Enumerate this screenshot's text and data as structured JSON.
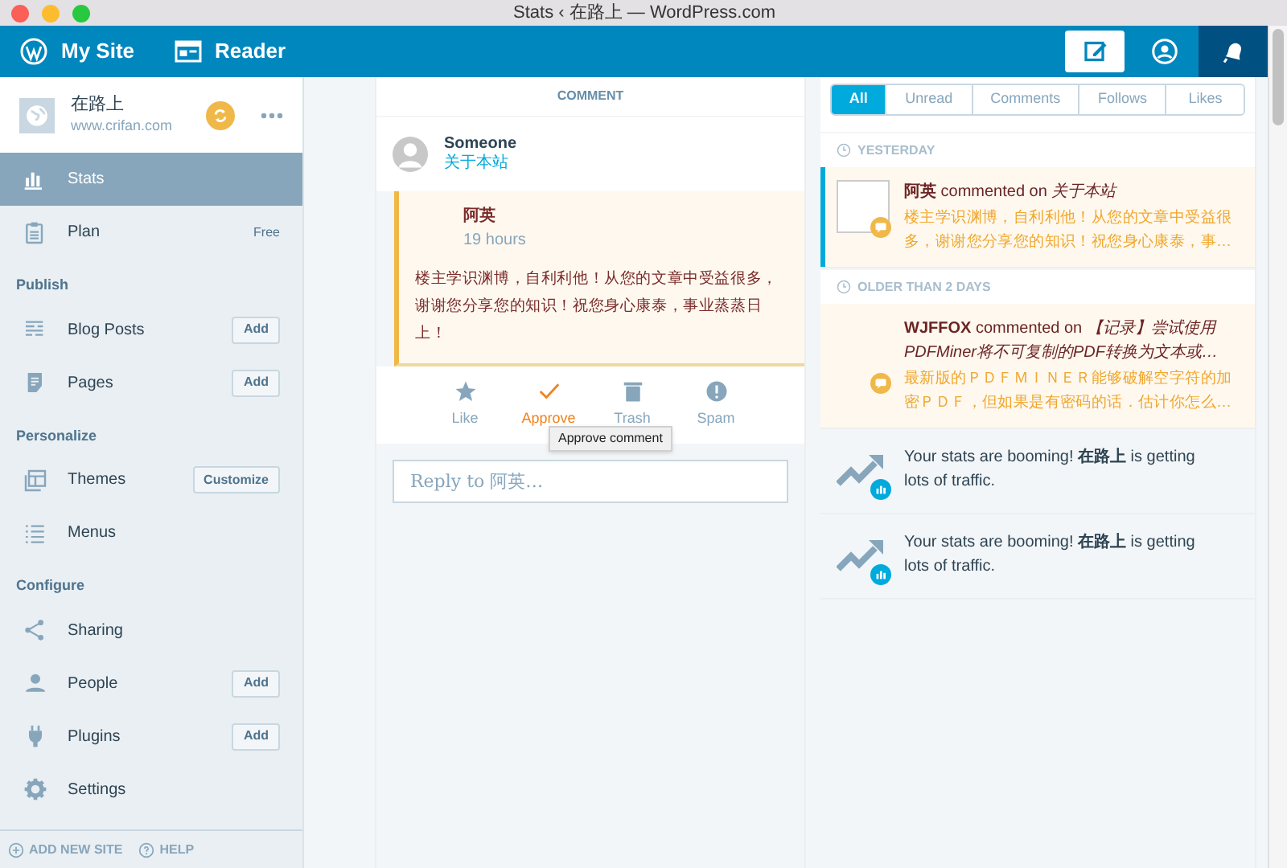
{
  "window": {
    "title": "Stats ‹ 在路上 — WordPress.com"
  },
  "topbar": {
    "nav": [
      {
        "label": "My Site"
      },
      {
        "label": "Reader"
      }
    ],
    "actions": [
      {
        "selected": false
      },
      {
        "selected": false
      },
      {
        "selected": true
      }
    ]
  },
  "site": {
    "name": "在路上",
    "url": "www.crifan.com"
  },
  "sidebar": {
    "sections": [
      {
        "items": [
          {
            "label": "Stats",
            "selected": true
          },
          {
            "label": "Plan",
            "selected": false,
            "badge": "Free"
          }
        ]
      },
      {
        "heading": "Publish",
        "items": [
          {
            "label": "Blog Posts",
            "selected": false,
            "button": "Add"
          },
          {
            "label": "Pages",
            "selected": false,
            "button": "Add"
          }
        ]
      },
      {
        "heading": "Personalize",
        "items": [
          {
            "label": "Themes",
            "selected": false,
            "button": "Customize"
          },
          {
            "label": "Menus",
            "selected": false
          }
        ]
      },
      {
        "heading": "Configure",
        "items": [
          {
            "label": "Sharing",
            "selected": false
          },
          {
            "label": "People",
            "selected": false,
            "button": "Add"
          },
          {
            "label": "Plugins",
            "selected": false,
            "button": "Add"
          },
          {
            "label": "Settings",
            "selected": false
          }
        ]
      }
    ],
    "footer": [
      {
        "label": "ADD NEW SITE"
      },
      {
        "label": "HELP"
      }
    ]
  },
  "comment": {
    "header": "COMMENT",
    "post_author": "Someone",
    "post_title": "关于本站",
    "author": "阿英",
    "time": "19 hours",
    "text": "楼主学识渊博，自利利他！从您的文章中受益很多，谢谢您分享您的知识！祝您身心康泰，事业蒸蒸日上！",
    "actions": [
      {
        "label": "Like",
        "active": false
      },
      {
        "label": "Approve",
        "active": true
      },
      {
        "label": "Trash",
        "active": false
      },
      {
        "label": "Spam",
        "active": false
      }
    ],
    "tooltip": "Approve comment",
    "reply_placeholder": "Reply to 阿英…"
  },
  "notifications": {
    "filters": [
      {
        "label": "All",
        "selected": true
      },
      {
        "label": "Unread",
        "selected": false
      },
      {
        "label": "Comments",
        "selected": false
      },
      {
        "label": "Follows",
        "selected": false
      },
      {
        "label": "Likes",
        "selected": false
      }
    ],
    "groups": [
      {
        "heading": "YESTERDAY",
        "items": [
          {
            "kind": "comment",
            "unread": true,
            "avatar": true,
            "title": "**阿英** commented on *关于本站*",
            "body": "楼主学识渊博，自利利他！从您的文章中受益很多，谢谢您分享您的知识！祝您身心康泰，事…"
          }
        ]
      },
      {
        "heading": "OLDER THAN 2 DAYS",
        "items": [
          {
            "kind": "comment",
            "unread": false,
            "avatar": false,
            "title": "**WJFFOX** commented on *【记录】尝试使用PDFMiner将不可复制的PDF转换为文本或…*",
            "body": "最新版的ＰＤＦＭＩＮＥＲ能够破解空字符的加密ＰＤＦ，但如果是有密码的话．估计你怎么…"
          },
          {
            "kind": "traffic",
            "unread": false,
            "title": "Your stats are booming! **在路上** is getting lots of traffic."
          },
          {
            "kind": "traffic",
            "unread": false,
            "title": "Your stats are booming! **在路上** is getting lots of traffic."
          }
        ]
      }
    ]
  }
}
